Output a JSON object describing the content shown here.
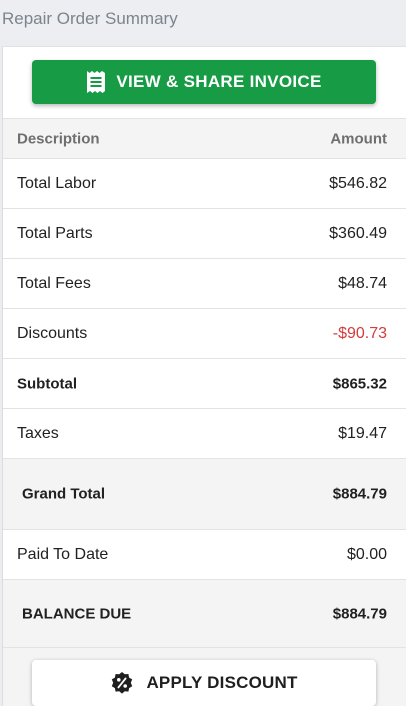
{
  "header": {
    "title": "Repair Order Summary"
  },
  "actions": {
    "invoice_label": "VIEW & SHARE INVOICE",
    "invoice_icon": "receipt-icon",
    "discount_label": "APPLY DISCOUNT",
    "discount_icon": "percent-badge-icon"
  },
  "table": {
    "columns": {
      "description": "Description",
      "amount": "Amount"
    },
    "rows": [
      {
        "label": "Total Labor",
        "value": "$546.82"
      },
      {
        "label": "Total Parts",
        "value": "$360.49"
      },
      {
        "label": "Total Fees",
        "value": "$48.74"
      },
      {
        "label": "Discounts",
        "value": "-$90.73"
      },
      {
        "label": "Subtotal",
        "value": "$865.32"
      },
      {
        "label": "Taxes",
        "value": "$19.47"
      },
      {
        "label": "Grand Total",
        "value": "$884.79"
      },
      {
        "label": "Paid To Date",
        "value": "$0.00"
      },
      {
        "label": "BALANCE DUE",
        "value": "$884.79"
      }
    ]
  },
  "colors": {
    "primary_button": "#179c45",
    "negative_amount": "#d23c3c",
    "header_text": "#7d848d"
  }
}
